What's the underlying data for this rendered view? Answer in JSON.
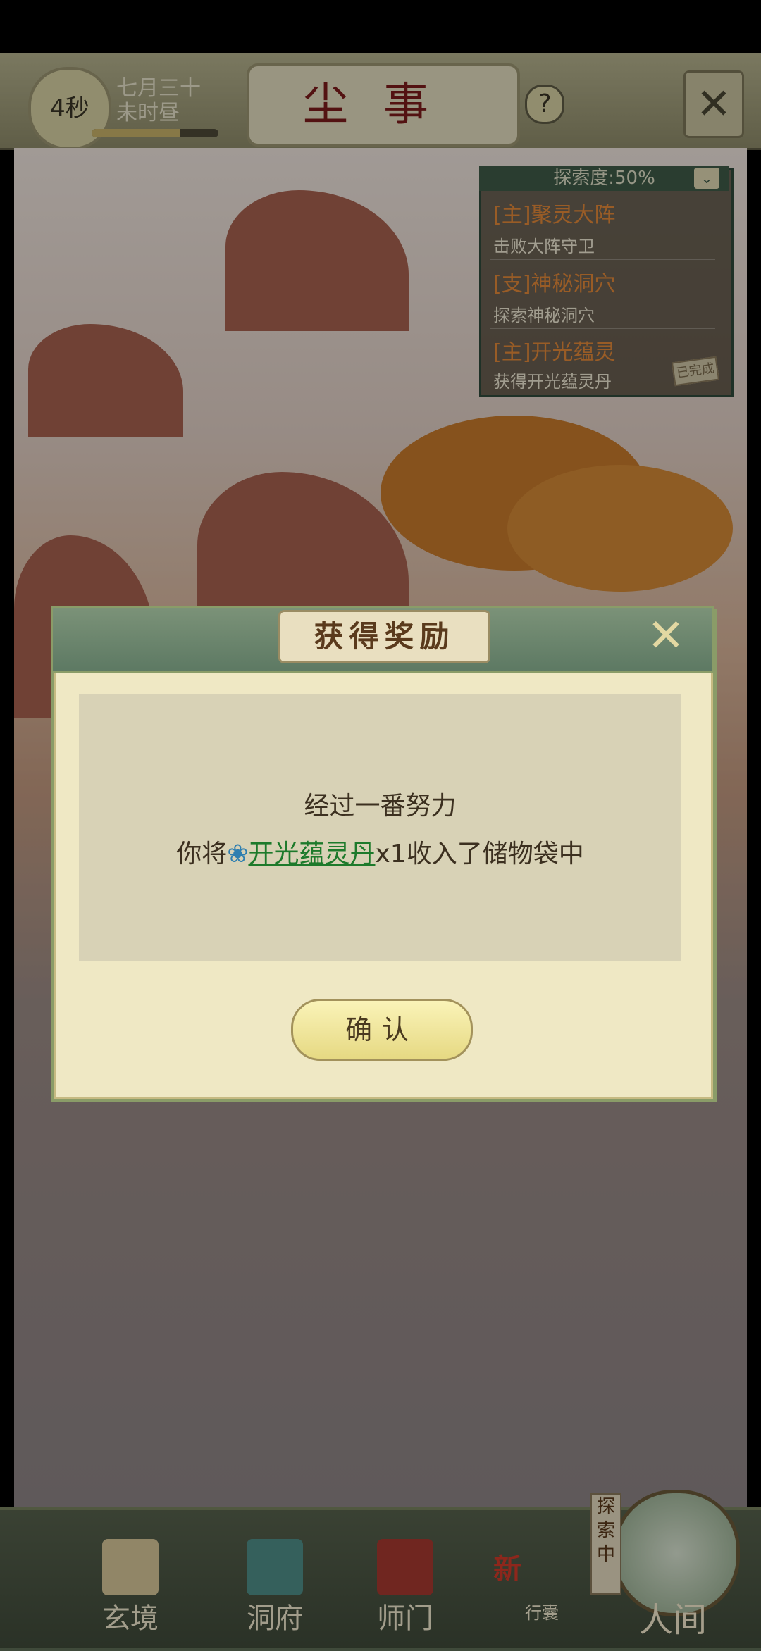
{
  "header": {
    "timer": "4秒",
    "date_line1": "七月三十",
    "date_line2": "未时昼",
    "progress_fraction": 0.7,
    "title": "尘事",
    "help_symbol": "?",
    "close_symbol": "✕"
  },
  "quest_panel": {
    "header": "探索度:50%",
    "toggle_symbol": "⌄",
    "quests": [
      {
        "title": "[主]聚灵大阵",
        "desc": "击败大阵守卫"
      },
      {
        "title": "[支]神秘洞穴",
        "desc": "探索神秘洞穴"
      },
      {
        "title": "[主]开光蕴灵",
        "desc": "获得开光蕴灵丹"
      }
    ],
    "done_stamp": "已完成"
  },
  "dialog": {
    "title": "获得奖励",
    "close_symbol": "✕",
    "line1": "经过一番努力",
    "line2_prefix": "你将",
    "item_icon": "❀",
    "item_name": "开光蕴灵丹",
    "line2_suffix": "x1收入了储物袋中",
    "confirm_label": "确认"
  },
  "bottom_nav": {
    "items": [
      {
        "label": "玄境",
        "icon": "scroll-icon"
      },
      {
        "label": "洞府",
        "icon": "pavilion-icon"
      },
      {
        "label": "师门",
        "icon": "banner-icon"
      }
    ],
    "pack_new": "新",
    "pack_label": "行囊",
    "explore_badge": "探索中",
    "renjian_label": "人间"
  },
  "colors": {
    "title_red": "#7d1b1b",
    "quest_orange": "#e58a3a",
    "item_green": "#1d7a2b",
    "dialog_bg": "#efe8c4"
  }
}
